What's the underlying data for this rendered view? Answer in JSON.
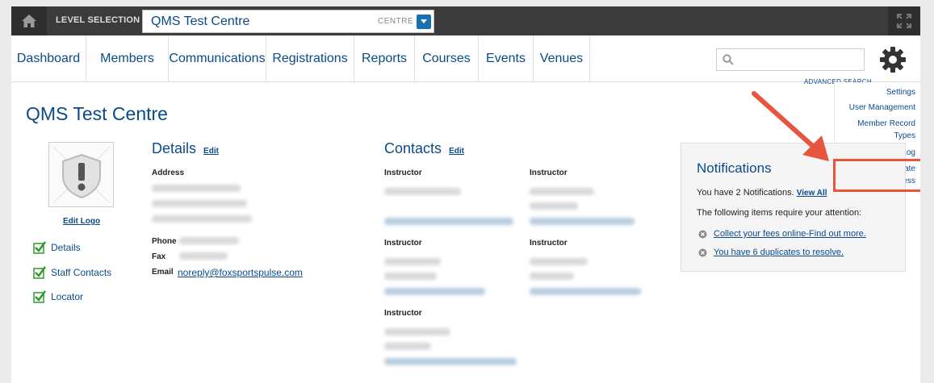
{
  "topbar": {
    "level_label": "LEVEL SELECTION",
    "level_value": "QMS Test Centre",
    "level_type": "CENTRE"
  },
  "nav": {
    "items": [
      "Dashboard",
      "Members",
      "Communications",
      "Registrations",
      "Reports",
      "Courses",
      "Events",
      "Venues"
    ],
    "search_placeholder": "",
    "advanced_search": "ADVANCED SEARCH"
  },
  "settings_menu": {
    "items": [
      "Settings",
      "User Management",
      "Member Record",
      "Types",
      "Audit Log",
      "Course Template",
      "Access"
    ]
  },
  "page": {
    "title": "QMS Test Centre",
    "edit_logo": "Edit Logo",
    "checklist": [
      "Details",
      "Staff Contacts",
      "Locator"
    ]
  },
  "details": {
    "title": "Details",
    "edit": "Edit",
    "address_label": "Address",
    "phone_label": "Phone",
    "fax_label": "Fax",
    "email_label": "Email",
    "email_value": "noreply@foxsportspulse.com"
  },
  "contacts": {
    "title": "Contacts",
    "edit": "Edit",
    "role_label": "Instructor"
  },
  "notifications": {
    "title": "Notifications",
    "summary_prefix": "You have 2 Notifications.",
    "view_all": "View All",
    "attention": "The following items require your attention:",
    "items": [
      "Collect your fees online-Find out more.",
      "You have 6 duplicates to resolve."
    ]
  },
  "colors": {
    "brand": "#0a4a8a",
    "topbar": "#3b3b3b",
    "annotation": "#e8553f",
    "check": "#2e9a2e"
  },
  "icons": [
    "home-icon",
    "chevron-down-icon",
    "expand-icon",
    "search-icon",
    "gear-icon",
    "shield-alert-icon",
    "checkbox-checked-icon",
    "close-circle-icon",
    "arrow-annotation"
  ]
}
